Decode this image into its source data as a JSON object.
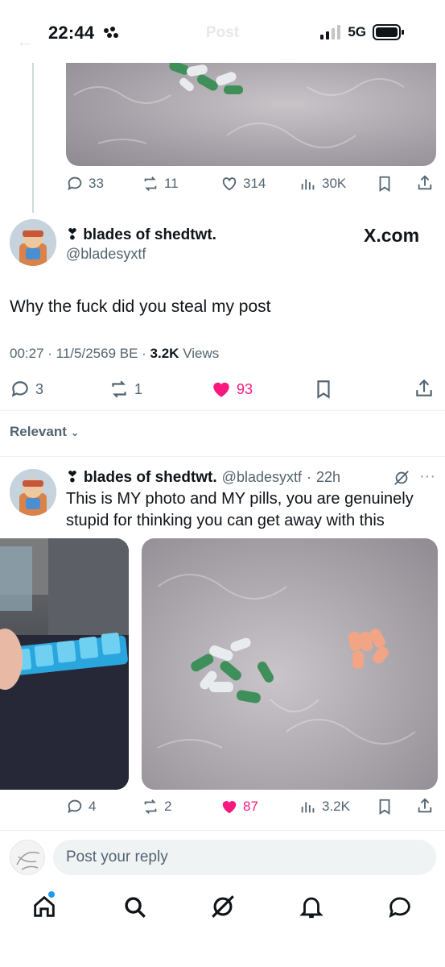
{
  "status": {
    "time": "22:44",
    "network": "5G"
  },
  "header": {
    "title": "Post"
  },
  "top_post_actions": {
    "replies": "33",
    "reposts": "11",
    "likes": "314",
    "views": "30K"
  },
  "main_post": {
    "display_name": "blades of shedtwt.",
    "handle": "@bladesyxtf",
    "source": "X.com",
    "text": "Why the fuck did you steal my post",
    "time": "00:27",
    "date": "11/5/2569 BE",
    "views_count": "3.2K",
    "views_label": "Views",
    "replies": "3",
    "reposts": "1",
    "likes": "93"
  },
  "sort": {
    "label": "Relevant"
  },
  "reply": {
    "display_name": "blades of shedtwt.",
    "handle": "@bladesyxtf",
    "age": "22h",
    "text": "This is MY photo and MY pills, you are genuinely stupid for thinking you can get away with this",
    "replies": "4",
    "reposts": "2",
    "likes": "87",
    "views": "3.2K"
  },
  "composer": {
    "placeholder": "Post your reply"
  },
  "colors": {
    "like_pink": "#f91880",
    "text_secondary": "#536471",
    "accent_blue": "#1d9bf0"
  },
  "icons": [
    "reply-icon",
    "repost-icon",
    "like-icon",
    "views-icon",
    "bookmark-icon",
    "share-icon",
    "home-icon",
    "search-icon",
    "grok-icon",
    "notifications-icon",
    "messages-icon"
  ]
}
